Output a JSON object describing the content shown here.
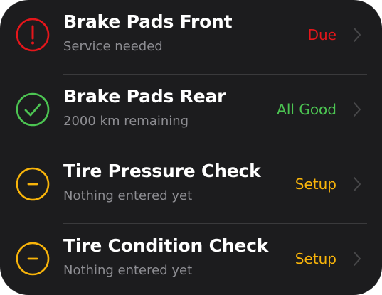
{
  "colors": {
    "background": "#1c1c1e",
    "divider": "#3a3a3c",
    "title": "#ffffff",
    "subtitle": "#8e8e93",
    "chevron": "#48484a",
    "status_due": "#e5161b",
    "status_ok": "#4cc552",
    "status_setup": "#f8b40a"
  },
  "items": [
    {
      "title": "Brake Pads Front",
      "subtitle": "Service needed",
      "status": "Due",
      "icon": "exclamation-circle-icon",
      "status_color": "#e5161b"
    },
    {
      "title": "Brake Pads Rear",
      "subtitle": "2000 km remaining",
      "status": "All Good",
      "icon": "checkmark-circle-icon",
      "status_color": "#4cc552"
    },
    {
      "title": "Tire Pressure Check",
      "subtitle": "Nothing entered yet",
      "status": "Setup",
      "icon": "minus-circle-icon",
      "status_color": "#f8b40a"
    },
    {
      "title": "Tire Condition Check",
      "subtitle": "Nothing entered yet",
      "status": "Setup",
      "icon": "minus-circle-icon",
      "status_color": "#f8b40a"
    }
  ]
}
